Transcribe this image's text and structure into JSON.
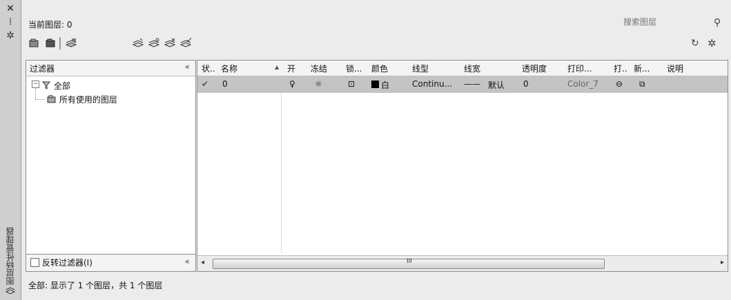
{
  "palette": {
    "close_glyph": "×",
    "autohide_glyph": "⁞",
    "props_glyph": "✲",
    "title": "图层特性管理器",
    "bottom_icon": "layer-stack-icon"
  },
  "toolbar": {
    "current_layer": "当前图层: 0",
    "search_placeholder": "搜索图层",
    "search_glyph": "⚲",
    "refresh_glyph": "↻",
    "settings_glyph": "✲"
  },
  "filter_panel": {
    "header": "过滤器",
    "collapse_glyph": "«",
    "tree": [
      {
        "label": "全部",
        "expand_glyph": "−"
      },
      {
        "label": "所有使用的图层"
      }
    ],
    "invert_label": "反转过滤器(I)",
    "footer_collapse_glyph": "«"
  },
  "grid": {
    "columns": [
      "状..",
      "名称",
      "开",
      "冻结",
      "锁...",
      "颜色",
      "线型",
      "线宽",
      "透明度",
      "打印...",
      "打..",
      "新...",
      "说明"
    ],
    "sort_glyph": "▲",
    "rows": [
      {
        "status_glyph": "✔",
        "name": "0",
        "on_glyph": "♀",
        "freeze_glyph": "☼",
        "lock_glyph": "⊡",
        "color_swatch": "#000000",
        "color_name": "白",
        "linetype": "Continu...",
        "lineweight_glyph": "——",
        "lineweight": "默认",
        "transparency": "0",
        "plot_style": "Color_7",
        "plot_glyph": "⊖",
        "newvp_glyph": "⧉"
      }
    ],
    "scroll_left_glyph": "◂",
    "scroll_right_glyph": "▸",
    "scroll_grip": "III"
  },
  "status": "全部: 显示了 1 个图层，共 1 个图层"
}
